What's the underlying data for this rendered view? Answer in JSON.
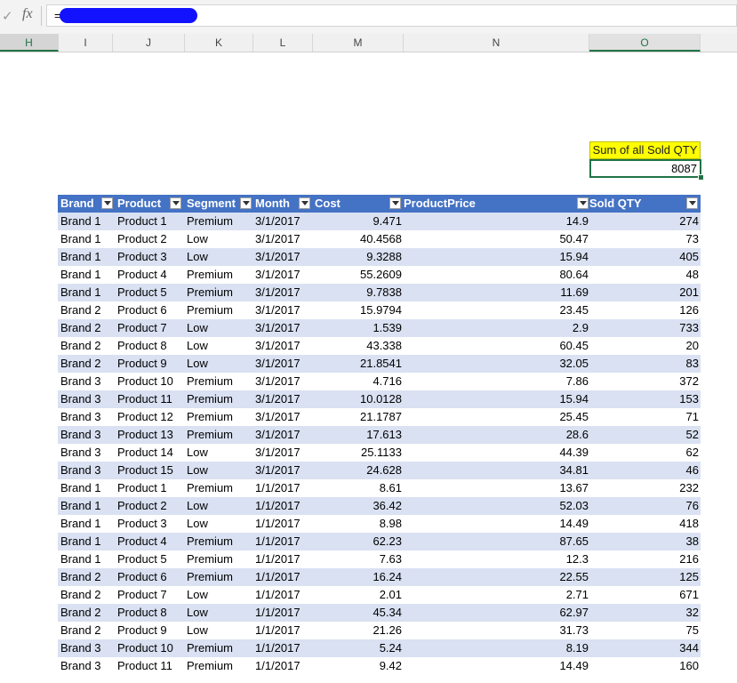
{
  "formula_bar": {
    "check": "✓",
    "fx": "fx",
    "text": "="
  },
  "columns": [
    {
      "label": "H",
      "state": "row"
    },
    {
      "label": "I",
      "state": ""
    },
    {
      "label": "J",
      "state": ""
    },
    {
      "label": "K",
      "state": ""
    },
    {
      "label": "L",
      "state": ""
    },
    {
      "label": "M",
      "state": ""
    },
    {
      "label": "N",
      "state": ""
    },
    {
      "label": "O",
      "state": "col"
    }
  ],
  "summary": {
    "label": "Sum of all Sold QTY",
    "value": "8087"
  },
  "table": {
    "headers": [
      "Brand",
      "Product",
      "Segment",
      "Month",
      "Cost",
      "ProductPrice",
      "Sold QTY"
    ],
    "rows": [
      [
        "Brand 1",
        "Product 1",
        "Premium",
        "3/1/2017",
        "9.471",
        "14.9",
        "274"
      ],
      [
        "Brand 1",
        "Product 2",
        "Low",
        "3/1/2017",
        "40.4568",
        "50.47",
        "73"
      ],
      [
        "Brand 1",
        "Product 3",
        "Low",
        "3/1/2017",
        "9.3288",
        "15.94",
        "405"
      ],
      [
        "Brand 1",
        "Product 4",
        "Premium",
        "3/1/2017",
        "55.2609",
        "80.64",
        "48"
      ],
      [
        "Brand 1",
        "Product 5",
        "Premium",
        "3/1/2017",
        "9.7838",
        "11.69",
        "201"
      ],
      [
        "Brand 2",
        "Product 6",
        "Premium",
        "3/1/2017",
        "15.9794",
        "23.45",
        "126"
      ],
      [
        "Brand 2",
        "Product 7",
        "Low",
        "3/1/2017",
        "1.539",
        "2.9",
        "733"
      ],
      [
        "Brand 2",
        "Product 8",
        "Low",
        "3/1/2017",
        "43.338",
        "60.45",
        "20"
      ],
      [
        "Brand 2",
        "Product 9",
        "Low",
        "3/1/2017",
        "21.8541",
        "32.05",
        "83"
      ],
      [
        "Brand 3",
        "Product 10",
        "Premium",
        "3/1/2017",
        "4.716",
        "7.86",
        "372"
      ],
      [
        "Brand 3",
        "Product 11",
        "Premium",
        "3/1/2017",
        "10.0128",
        "15.94",
        "153"
      ],
      [
        "Brand 3",
        "Product 12",
        "Premium",
        "3/1/2017",
        "21.1787",
        "25.45",
        "71"
      ],
      [
        "Brand 3",
        "Product 13",
        "Premium",
        "3/1/2017",
        "17.613",
        "28.6",
        "52"
      ],
      [
        "Brand 3",
        "Product 14",
        "Low",
        "3/1/2017",
        "25.1133",
        "44.39",
        "62"
      ],
      [
        "Brand 3",
        "Product 15",
        "Low",
        "3/1/2017",
        "24.628",
        "34.81",
        "46"
      ],
      [
        "Brand 1",
        "Product 1",
        "Premium",
        "1/1/2017",
        "8.61",
        "13.67",
        "232"
      ],
      [
        "Brand 1",
        "Product 2",
        "Low",
        "1/1/2017",
        "36.42",
        "52.03",
        "76"
      ],
      [
        "Brand 1",
        "Product 3",
        "Low",
        "1/1/2017",
        "8.98",
        "14.49",
        "418"
      ],
      [
        "Brand 1",
        "Product 4",
        "Premium",
        "1/1/2017",
        "62.23",
        "87.65",
        "38"
      ],
      [
        "Brand 1",
        "Product 5",
        "Premium",
        "1/1/2017",
        "7.63",
        "12.3",
        "216"
      ],
      [
        "Brand 2",
        "Product 6",
        "Premium",
        "1/1/2017",
        "16.24",
        "22.55",
        "125"
      ],
      [
        "Brand 2",
        "Product 7",
        "Low",
        "1/1/2017",
        "2.01",
        "2.71",
        "671"
      ],
      [
        "Brand 2",
        "Product 8",
        "Low",
        "1/1/2017",
        "45.34",
        "62.97",
        "32"
      ],
      [
        "Brand 2",
        "Product 9",
        "Low",
        "1/1/2017",
        "21.26",
        "31.73",
        "75"
      ],
      [
        "Brand 3",
        "Product 10",
        "Premium",
        "1/1/2017",
        "5.24",
        "8.19",
        "344"
      ],
      [
        "Brand 3",
        "Product 11",
        "Premium",
        "1/1/2017",
        "9.42",
        "14.49",
        "160"
      ]
    ]
  },
  "colors": {
    "header": "#4472c4",
    "band": "#d9e1f2",
    "highlight": "#ffff00",
    "accent": "#217346"
  }
}
